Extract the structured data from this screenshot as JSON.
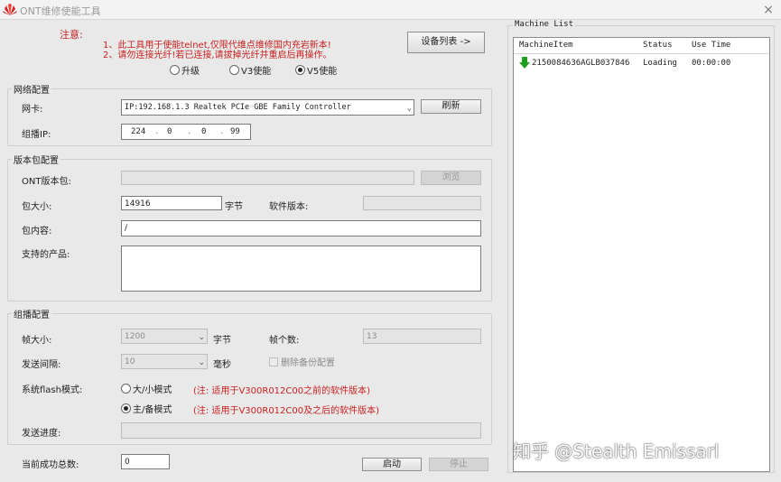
{
  "window": {
    "title": "ONT维修使能工具",
    "close": "×"
  },
  "notice": {
    "label": "注意:",
    "line1": "1、此工具用于使能telnet,仅限代维点维修国内充岩新本!",
    "line2": "2、请勿连接光纤!若已连接,请拔掉光纤并重启后再操作。"
  },
  "device_list_button": "设备列表 ->",
  "mode": {
    "options": [
      "升级",
      "V3使能",
      "V5使能"
    ],
    "selected": "V5使能"
  },
  "network": {
    "group_label": "网络配置",
    "nic_label": "网卡:",
    "nic_value": "IP:192.168.1.3 Realtek PCIe GBE Family Controller",
    "refresh_button": "刷新",
    "multicast_ip_label": "组播IP:",
    "multicast_ip": [
      "224",
      "0",
      "0",
      "99"
    ]
  },
  "package": {
    "group_label": "版本包配置",
    "ont_pkg_label": "ONT版本包:",
    "ont_pkg_value": "",
    "browse_button": "浏览",
    "size_label": "包大小:",
    "size_value": "14916",
    "size_unit": "字节",
    "software_version_label": "软件版本:",
    "software_version_value": "",
    "content_label": "包内容:",
    "content_value": "/",
    "products_label": "支持的产品:",
    "products_value": ""
  },
  "multicast": {
    "group_label": "组播配置",
    "frame_size_label": "帧大小:",
    "frame_size_value": "1200",
    "frame_size_unit": "字节",
    "frame_count_label": "帧个数:",
    "frame_count_value": "13",
    "interval_label": "发送间隔:",
    "interval_value": "10",
    "interval_unit": "毫秒",
    "remove_backup_label": "删除备份配置",
    "flash_mode_label": "系统flash模式:",
    "flash_option_1": "大/小模式",
    "flash_note_1": "(注: 适用于V300R012C00之前的软件版本)",
    "flash_option_2": "主/备模式",
    "flash_note_2": "(注: 适用于V300R012C00及之后的软件版本)",
    "flash_selected": "主/备模式",
    "progress_label": "发送进度:",
    "progress": 0
  },
  "footer": {
    "success_total_label": "当前成功总数:",
    "success_total_value": "0",
    "start_button": "启动",
    "stop_button": "停止"
  },
  "machine_list": {
    "title": "Machine List",
    "columns": [
      "MachineItem",
      "Status",
      "Use Time"
    ],
    "rows": [
      {
        "item": "2150084636AGLB037846",
        "status": "Loading",
        "use_time": "00:00:00"
      }
    ]
  },
  "watermark": "知乎 @Stealth Emissarl",
  "colors": {
    "notice_red": "#c82020",
    "arrow_green": "#1ea01e",
    "logo_red": "#d81e1e"
  }
}
